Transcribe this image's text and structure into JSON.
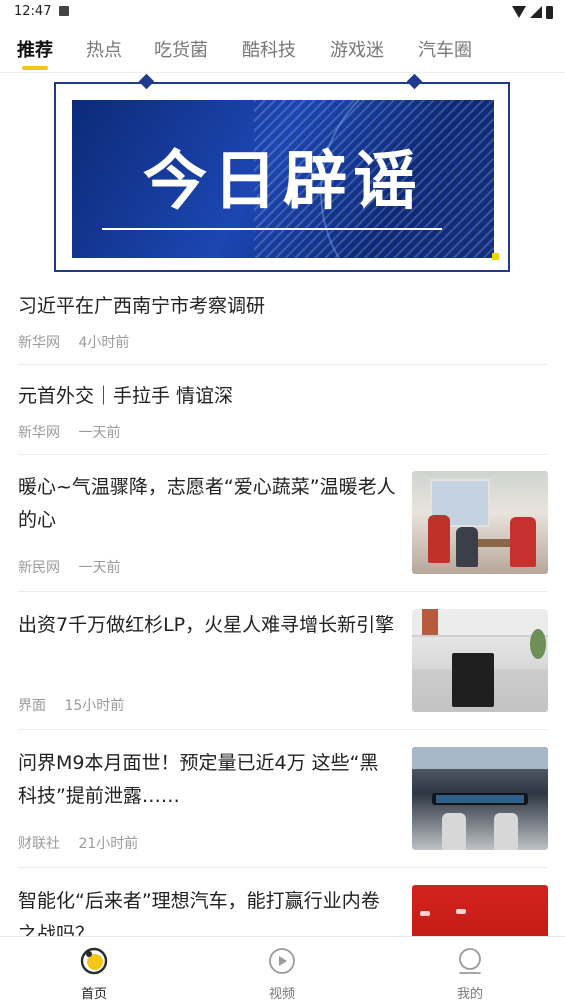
{
  "status_bar": {
    "time": "12:47"
  },
  "tabs": [
    {
      "label": "推荐"
    },
    {
      "label": "热点"
    },
    {
      "label": "吃货菌"
    },
    {
      "label": "酷科技"
    },
    {
      "label": "游戏迷"
    },
    {
      "label": "汽车圈"
    }
  ],
  "banner": {
    "title": "今日辟谣"
  },
  "news": [
    {
      "title": "习近平在广西南宁市考察调研",
      "source": "新华网",
      "time": "4小时前"
    },
    {
      "title": "元首外交｜手拉手 情谊深",
      "source": "新华网",
      "time": "一天前"
    },
    {
      "title": "暖心~气温骤降，志愿者“爱心蔬菜”温暖老人的心",
      "source": "新民网",
      "time": "一天前"
    },
    {
      "title": "出资7千万做红杉LP，火星人难寻增长新引擎",
      "source": "界面",
      "time": "15小时前"
    },
    {
      "title": "问界M9本月面世！预定量已近4万 这些“黑科技”提前泄露……",
      "source": "财联社",
      "time": "21小时前"
    },
    {
      "title": "智能化“后来者”理想汽车，能打赢行业内卷之战吗？"
    }
  ],
  "bottom_nav": [
    {
      "label": "首页",
      "icon": "home-icon"
    },
    {
      "label": "视频",
      "icon": "play-icon"
    },
    {
      "label": "我的",
      "icon": "profile-icon"
    }
  ],
  "colors": {
    "accent": "#f5c518",
    "banner_blue": "#1f3c8c"
  }
}
